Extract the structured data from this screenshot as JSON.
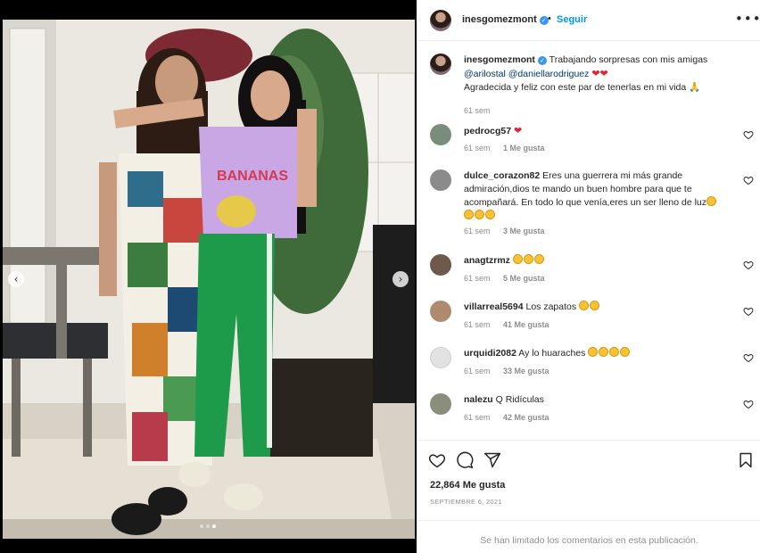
{
  "post": {
    "username": "inesgomezmont",
    "verified": true,
    "follow_label": "Seguir",
    "separator": "•",
    "more_label": "•••",
    "photo_alt": "Dos mujeres posando en un patio",
    "nav_prev": "‹",
    "nav_next": "›",
    "carousel_total": 3,
    "carousel_active": 3
  },
  "caption": {
    "username": "inesgomezmont",
    "text_1": "Trabajando sorpresas con mis amigas",
    "mention_1": "@arilostal",
    "mention_2": "@daniellarodriguez",
    "hearts": "❤❤",
    "text_2": "Agradecida y feliz con este par de tenerlas en mi vida",
    "emoji_2": "🙏",
    "time": "61 sem"
  },
  "comments": [
    {
      "username": "pedrocg57",
      "text": "",
      "emoji": "❤",
      "time": "61 sem",
      "likes": "1 Me gusta",
      "avatar_color": "#7a8c7a"
    },
    {
      "username": "dulce_corazon82",
      "text": "Eres una guerrera mi más grande admiración,dios te mando un buen hombre para que te acompañará. En todo lo que venía,eres un ser lleno de luz",
      "emoji_count": 4,
      "time": "61 sem",
      "likes": "3 Me gusta",
      "avatar_color": "#8b8b8b"
    },
    {
      "username": "anagtzrmz",
      "text": "",
      "emoji_count": 3,
      "time": "61 sem",
      "likes": "5 Me gusta",
      "avatar_color": "#6d5a4b"
    },
    {
      "username": "villarreal5694",
      "text": "Los zapatos",
      "emoji_count": 2,
      "time": "61 sem",
      "likes": "41 Me gusta",
      "avatar_color": "#b08a6e"
    },
    {
      "username": "urquidi2082",
      "text": "Ay lo huaraches",
      "emoji_count": 4,
      "time": "61 sem",
      "likes": "33 Me gusta",
      "avatar_color": "#e2e2e2"
    },
    {
      "username": "nalezu",
      "text": "Q Ridículas",
      "emoji_count": 0,
      "time": "61 sem",
      "likes": "42 Me gusta",
      "avatar_color": "#8a8f7c"
    }
  ],
  "actions": {
    "like_icon": "heart-icon",
    "comment_icon": "comment-icon",
    "share_icon": "share-icon",
    "save_icon": "bookmark-icon",
    "likes_count": "22,864 Me gusta",
    "date": "SEPTIEMBRE 6, 2021"
  },
  "footer": {
    "limited_text": "Se han limitado los comentarios en esta publicación."
  },
  "colors": {
    "accent": "#0095f6",
    "verified": "#3897f0",
    "muted": "#8e8e8e",
    "heart_red": "#e0253a"
  }
}
